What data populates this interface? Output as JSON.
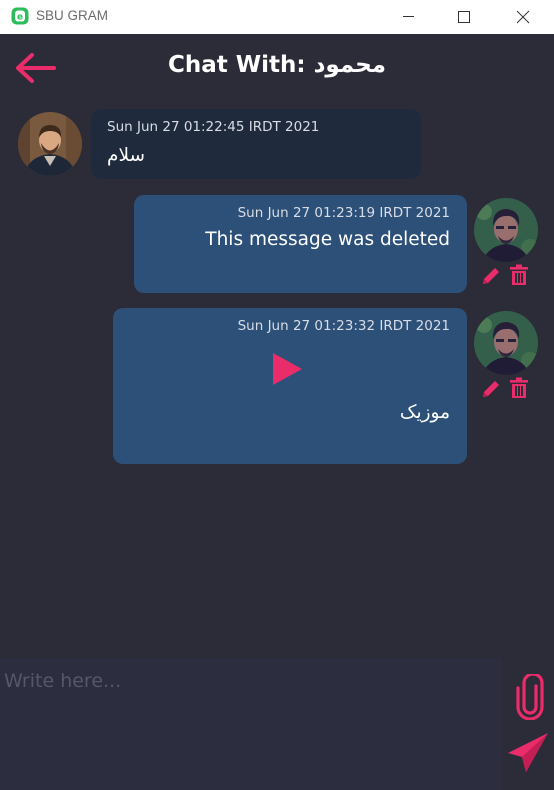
{
  "window": {
    "title": "SBU GRAM"
  },
  "header": {
    "chat_prefix": "Chat With:",
    "contact_name": "محمود"
  },
  "messages": [
    {
      "direction": "incoming",
      "timestamp": "Sun Jun 27 01:22:45 IRDT 2021",
      "text": "سلام"
    },
    {
      "direction": "outgoing",
      "timestamp": "Sun Jun 27 01:23:19 IRDT 2021",
      "text": "This message was deleted"
    },
    {
      "direction": "outgoing",
      "timestamp": "Sun Jun 27 01:23:32 IRDT 2021",
      "text": "موزیک",
      "attachment_icon": "play-icon"
    }
  ],
  "composer": {
    "placeholder": "Write here...",
    "value": ""
  },
  "icons": {
    "back": "arrow-left-icon",
    "edit": "pencil-icon",
    "delete": "trash-icon",
    "attach": "paperclip-icon",
    "send": "send-icon"
  },
  "colors": {
    "accent": "#ea2c6a",
    "background": "#2b2c38",
    "incoming_bubble": "#1f2a3c",
    "outgoing_bubble": "#2d5079",
    "composer": "#2c2d3f"
  }
}
